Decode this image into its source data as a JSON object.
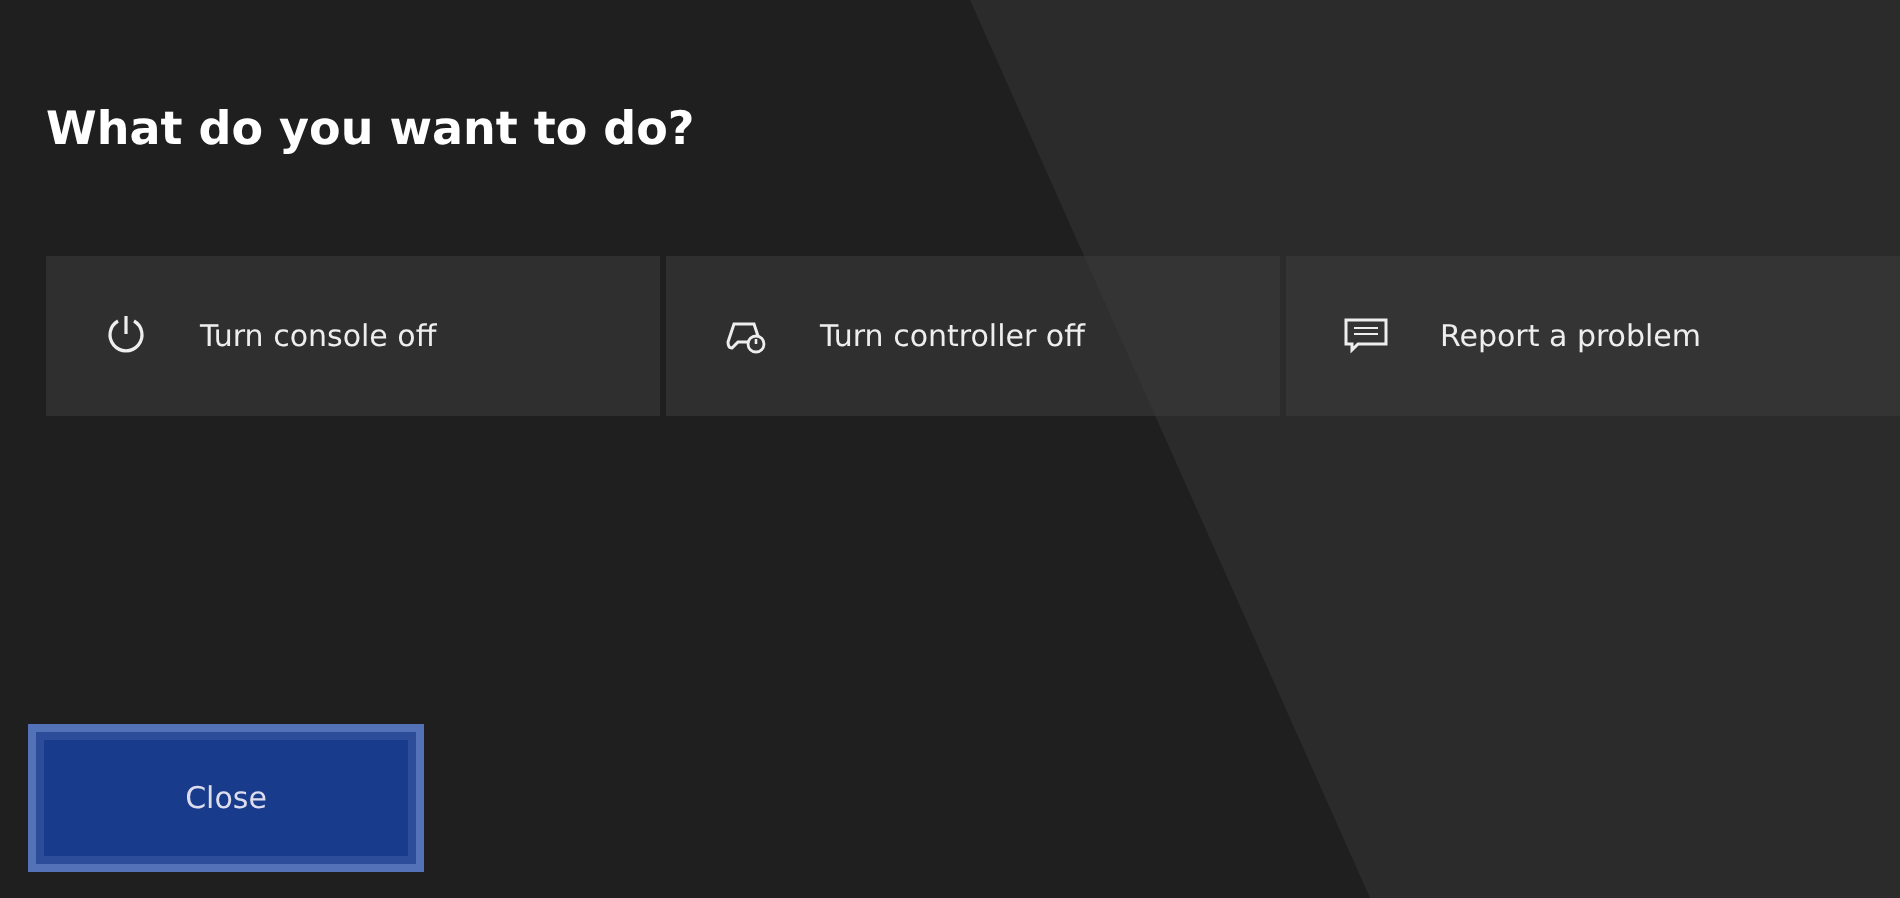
{
  "title": "What do you want to do?",
  "options": [
    {
      "kind": "power",
      "label": "Turn console off"
    },
    {
      "kind": "controller",
      "label": "Turn controller off"
    },
    {
      "kind": "feedback",
      "label": "Report a problem"
    }
  ],
  "close_button": {
    "label": "Close",
    "focused": true
  }
}
